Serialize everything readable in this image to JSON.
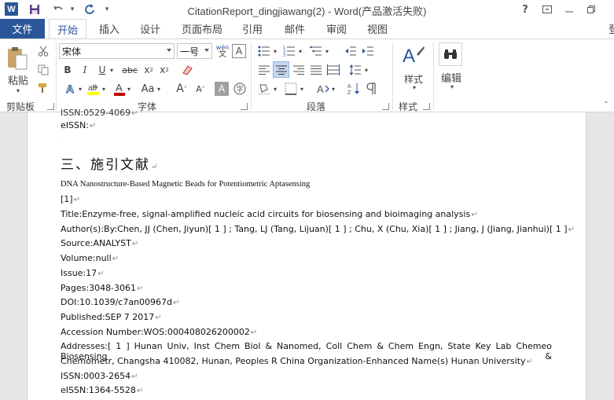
{
  "titlebar": {
    "app_icon": "W",
    "title": "CitationReport_dingjiawang(2) - Word(产品激活失败)",
    "icons": [
      "word-logo-icon",
      "save-icon",
      "undo-icon",
      "redo-icon",
      "customize-qat-icon",
      "help-icon",
      "ribbon-display-icon",
      "minimize-icon",
      "restore-icon"
    ]
  },
  "tabs": {
    "file": "文件",
    "items": [
      "开始",
      "插入",
      "设计",
      "页面布局",
      "引用",
      "邮件",
      "审阅",
      "视图"
    ],
    "active": "开始",
    "user": "登"
  },
  "ribbon": {
    "clipboard": {
      "paste": "粘贴",
      "group": "剪贴板"
    },
    "font": {
      "font_name": "宋体",
      "font_size": "一号",
      "group": "字体",
      "wen": "wén",
      "wen_char": "文",
      "aa_label": "Aa",
      "a_label": "A",
      "char_border": "A"
    },
    "paragraph": {
      "group": "段落"
    },
    "styles": {
      "label": "样式",
      "group": "样式"
    },
    "editing": {
      "label": "编辑"
    },
    "accent_color": "#2b579a"
  },
  "document": {
    "top_cut": "ISSN:0529-4069",
    "line1": "eISSN:",
    "heading": "三、施引文献",
    "subtitle": "DNA Nanostructure-Based Magnetic Beads for Potentiometric Aptasensing",
    "ref_num": "[1]",
    "title": "Title:Enzyme-free, signal-amplified nucleic acid circuits for biosensing and bioimaging analysis",
    "authors": "Author(s):By:Chen, JJ (Chen, Jiyun)[ 1 ] ; Tang, LJ (Tang, Lijuan)[ 1 ] ; Chu, X (Chu, Xia)[ 1 ] ; Jiang, J (Jiang, Jianhui)[ 1 ]",
    "source": "Source:ANALYST",
    "volume": "Volume:null",
    "issue": "Issue:17",
    "pages": "Pages:3048-3061",
    "doi": "DOI:10.1039/c7an00967d",
    "published": "Published:SEP 7 2017",
    "accession": "Accession Number:WOS:000408026200002",
    "addresses1": "Addresses:[ 1 ] Hunan Univ, Inst Chem Biol & Nanomed, Coll Chem & Chem Engn, State Key Lab Chemeo Biosensing &",
    "addresses2": "Chemometr, Changsha 410082, Hunan, Peoples R China    Organization-Enhanced Name(s)     Hunan University",
    "issn": "ISSN:0003-2654",
    "eissn": "eISSN:1364-5528",
    "para_mark": "↵"
  }
}
